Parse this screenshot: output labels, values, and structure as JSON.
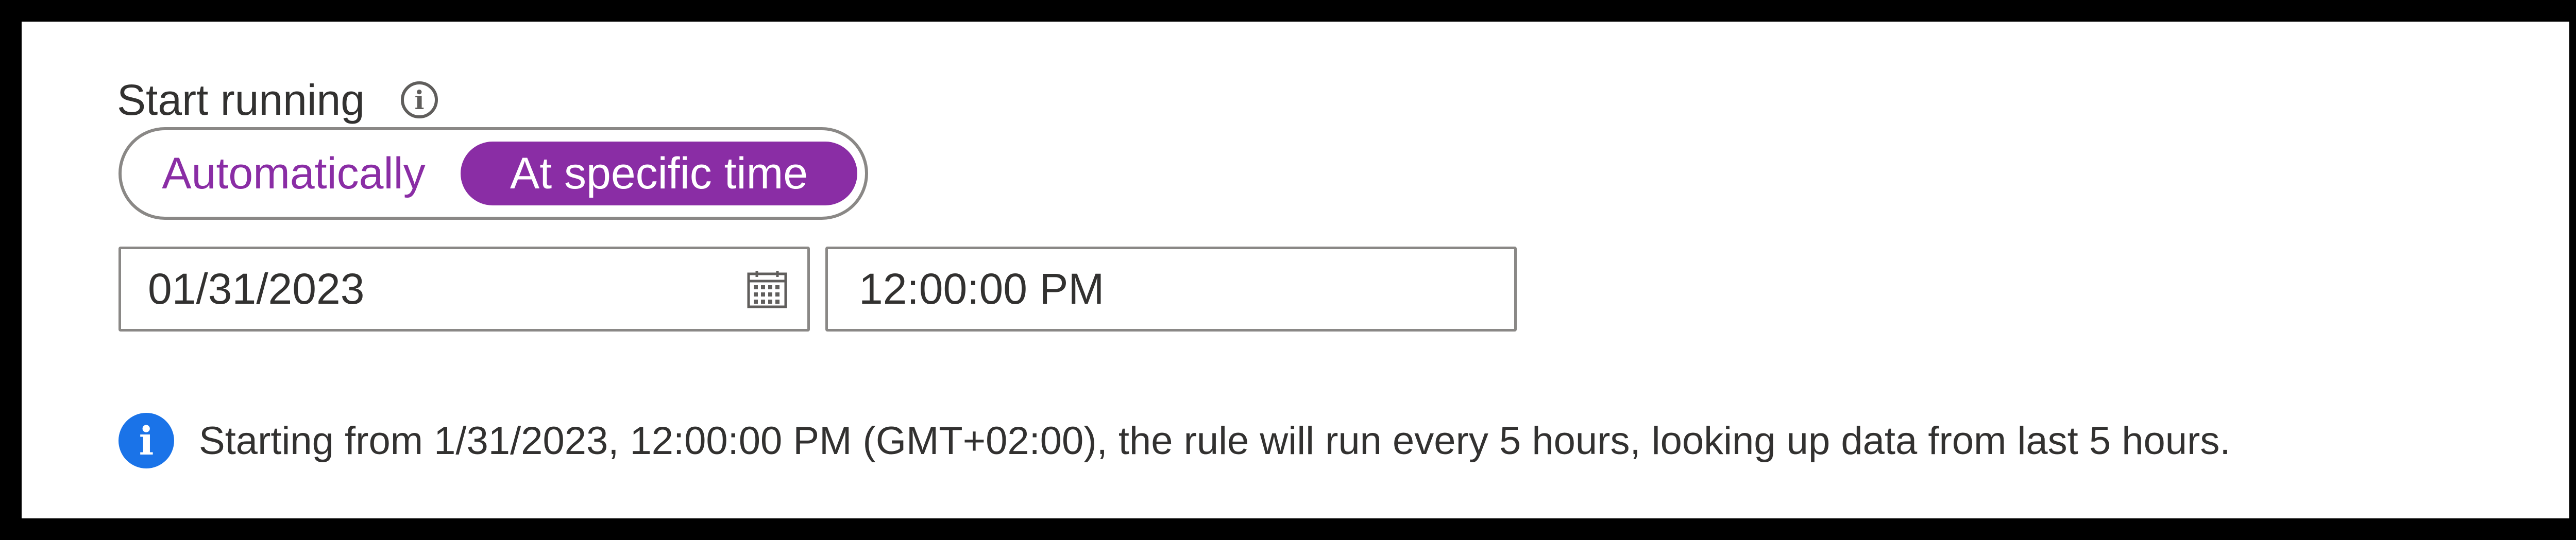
{
  "start_running": {
    "label": "Start running",
    "info_icon": "info-icon"
  },
  "toggle": {
    "options": [
      {
        "label": "Automatically",
        "selected": false
      },
      {
        "label": "At specific time",
        "selected": true
      }
    ],
    "accent_color": "#8a2da5"
  },
  "date_field": {
    "value": "01/31/2023",
    "icon": "calendar-icon"
  },
  "time_field": {
    "value": "12:00:00 PM"
  },
  "info_message": {
    "icon": "info-filled-icon",
    "icon_color": "#1a73e8",
    "text": "Starting from 1/31/2023, 12:00:00 PM (GMT+02:00), the rule will run every 5 hours, looking up data from last 5 hours."
  }
}
